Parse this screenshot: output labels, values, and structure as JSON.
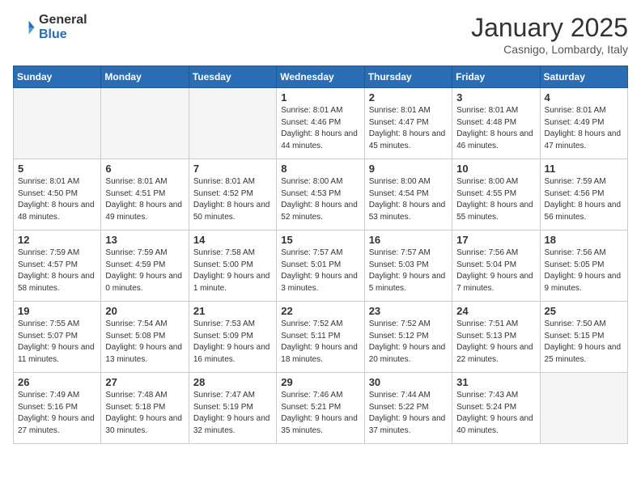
{
  "header": {
    "logo_general": "General",
    "logo_blue": "Blue",
    "title": "January 2025",
    "subtitle": "Casnigo, Lombardy, Italy"
  },
  "days_of_week": [
    "Sunday",
    "Monday",
    "Tuesday",
    "Wednesday",
    "Thursday",
    "Friday",
    "Saturday"
  ],
  "weeks": [
    [
      {
        "day": "",
        "info": ""
      },
      {
        "day": "",
        "info": ""
      },
      {
        "day": "",
        "info": ""
      },
      {
        "day": "1",
        "info": "Sunrise: 8:01 AM\nSunset: 4:46 PM\nDaylight: 8 hours\nand 44 minutes."
      },
      {
        "day": "2",
        "info": "Sunrise: 8:01 AM\nSunset: 4:47 PM\nDaylight: 8 hours\nand 45 minutes."
      },
      {
        "day": "3",
        "info": "Sunrise: 8:01 AM\nSunset: 4:48 PM\nDaylight: 8 hours\nand 46 minutes."
      },
      {
        "day": "4",
        "info": "Sunrise: 8:01 AM\nSunset: 4:49 PM\nDaylight: 8 hours\nand 47 minutes."
      }
    ],
    [
      {
        "day": "5",
        "info": "Sunrise: 8:01 AM\nSunset: 4:50 PM\nDaylight: 8 hours\nand 48 minutes."
      },
      {
        "day": "6",
        "info": "Sunrise: 8:01 AM\nSunset: 4:51 PM\nDaylight: 8 hours\nand 49 minutes."
      },
      {
        "day": "7",
        "info": "Sunrise: 8:01 AM\nSunset: 4:52 PM\nDaylight: 8 hours\nand 50 minutes."
      },
      {
        "day": "8",
        "info": "Sunrise: 8:00 AM\nSunset: 4:53 PM\nDaylight: 8 hours\nand 52 minutes."
      },
      {
        "day": "9",
        "info": "Sunrise: 8:00 AM\nSunset: 4:54 PM\nDaylight: 8 hours\nand 53 minutes."
      },
      {
        "day": "10",
        "info": "Sunrise: 8:00 AM\nSunset: 4:55 PM\nDaylight: 8 hours\nand 55 minutes."
      },
      {
        "day": "11",
        "info": "Sunrise: 7:59 AM\nSunset: 4:56 PM\nDaylight: 8 hours\nand 56 minutes."
      }
    ],
    [
      {
        "day": "12",
        "info": "Sunrise: 7:59 AM\nSunset: 4:57 PM\nDaylight: 8 hours\nand 58 minutes."
      },
      {
        "day": "13",
        "info": "Sunrise: 7:59 AM\nSunset: 4:59 PM\nDaylight: 9 hours\nand 0 minutes."
      },
      {
        "day": "14",
        "info": "Sunrise: 7:58 AM\nSunset: 5:00 PM\nDaylight: 9 hours\nand 1 minute."
      },
      {
        "day": "15",
        "info": "Sunrise: 7:57 AM\nSunset: 5:01 PM\nDaylight: 9 hours\nand 3 minutes."
      },
      {
        "day": "16",
        "info": "Sunrise: 7:57 AM\nSunset: 5:03 PM\nDaylight: 9 hours\nand 5 minutes."
      },
      {
        "day": "17",
        "info": "Sunrise: 7:56 AM\nSunset: 5:04 PM\nDaylight: 9 hours\nand 7 minutes."
      },
      {
        "day": "18",
        "info": "Sunrise: 7:56 AM\nSunset: 5:05 PM\nDaylight: 9 hours\nand 9 minutes."
      }
    ],
    [
      {
        "day": "19",
        "info": "Sunrise: 7:55 AM\nSunset: 5:07 PM\nDaylight: 9 hours\nand 11 minutes."
      },
      {
        "day": "20",
        "info": "Sunrise: 7:54 AM\nSunset: 5:08 PM\nDaylight: 9 hours\nand 13 minutes."
      },
      {
        "day": "21",
        "info": "Sunrise: 7:53 AM\nSunset: 5:09 PM\nDaylight: 9 hours\nand 16 minutes."
      },
      {
        "day": "22",
        "info": "Sunrise: 7:52 AM\nSunset: 5:11 PM\nDaylight: 9 hours\nand 18 minutes."
      },
      {
        "day": "23",
        "info": "Sunrise: 7:52 AM\nSunset: 5:12 PM\nDaylight: 9 hours\nand 20 minutes."
      },
      {
        "day": "24",
        "info": "Sunrise: 7:51 AM\nSunset: 5:13 PM\nDaylight: 9 hours\nand 22 minutes."
      },
      {
        "day": "25",
        "info": "Sunrise: 7:50 AM\nSunset: 5:15 PM\nDaylight: 9 hours\nand 25 minutes."
      }
    ],
    [
      {
        "day": "26",
        "info": "Sunrise: 7:49 AM\nSunset: 5:16 PM\nDaylight: 9 hours\nand 27 minutes."
      },
      {
        "day": "27",
        "info": "Sunrise: 7:48 AM\nSunset: 5:18 PM\nDaylight: 9 hours\nand 30 minutes."
      },
      {
        "day": "28",
        "info": "Sunrise: 7:47 AM\nSunset: 5:19 PM\nDaylight: 9 hours\nand 32 minutes."
      },
      {
        "day": "29",
        "info": "Sunrise: 7:46 AM\nSunset: 5:21 PM\nDaylight: 9 hours\nand 35 minutes."
      },
      {
        "day": "30",
        "info": "Sunrise: 7:44 AM\nSunset: 5:22 PM\nDaylight: 9 hours\nand 37 minutes."
      },
      {
        "day": "31",
        "info": "Sunrise: 7:43 AM\nSunset: 5:24 PM\nDaylight: 9 hours\nand 40 minutes."
      },
      {
        "day": "",
        "info": ""
      }
    ]
  ]
}
